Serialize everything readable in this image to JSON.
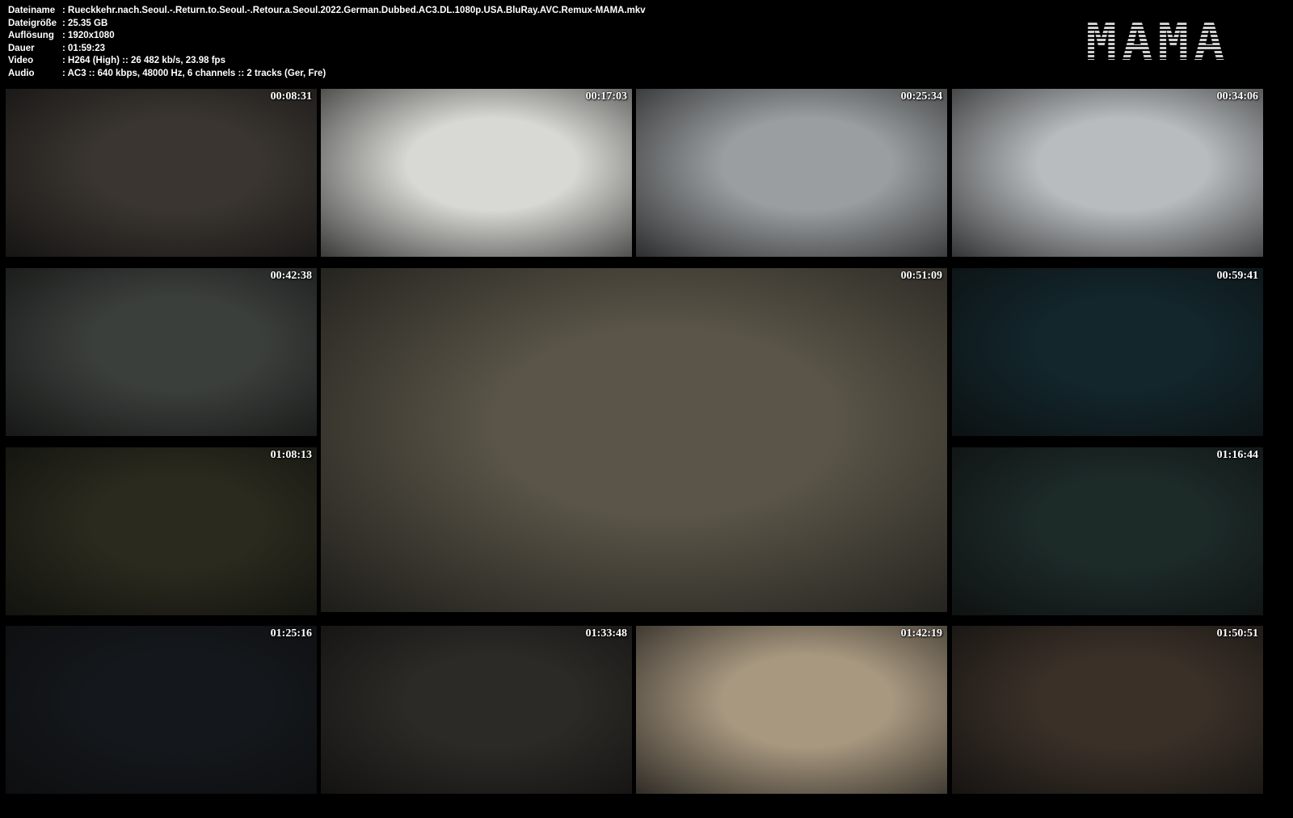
{
  "info": [
    {
      "label": "Dateiname",
      "value": ": Rueckkehr.nach.Seoul.-.Return.to.Seoul.-.Retour.a.Seoul.2022.German.Dubbed.AC3.DL.1080p.USA.BluRay.AVC.Remux-MAMA.mkv"
    },
    {
      "label": "Dateigröße",
      "value": ": 25.35 GB"
    },
    {
      "label": "Auflösung",
      "value": ": 1920x1080"
    },
    {
      "label": "Dauer",
      "value": ": 01:59:23"
    },
    {
      "label": "Video",
      "value": ": H264 (High) :: 26 482 kb/s, 23.98 fps"
    },
    {
      "label": "Audio",
      "value": ": AC3 :: 640 kbps, 48000 Hz, 6 channels :: 2 tracks (Ger, Fre)"
    }
  ],
  "logo": "MAMA",
  "frames": [
    {
      "time": "00:08:31",
      "color": "#3a3530"
    },
    {
      "time": "00:17:03",
      "color": "#d8d8d4"
    },
    {
      "time": "00:25:34",
      "color": "#9a9ea0"
    },
    {
      "time": "00:34:06",
      "color": "#b8bcbe"
    },
    {
      "time": "00:42:38",
      "color": "#3b3f3c"
    },
    {
      "time": "00:51:09",
      "color": "#5a5548"
    },
    {
      "time": "00:59:41",
      "color": "#12262c"
    },
    {
      "time": "01:08:13",
      "color": "#2a2a1e"
    },
    {
      "time": "01:16:44",
      "color": "#1c2a28"
    },
    {
      "time": "01:25:16",
      "color": "#14181c"
    },
    {
      "time": "01:33:48",
      "color": "#2c2a26"
    },
    {
      "time": "01:42:19",
      "color": "#a89880"
    },
    {
      "time": "01:50:51",
      "color": "#3a3028"
    }
  ]
}
